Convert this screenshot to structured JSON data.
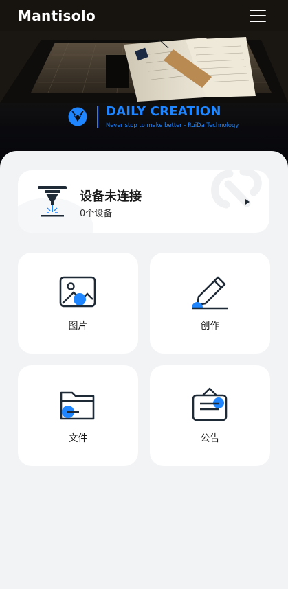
{
  "header": {
    "logo": "Mantisolo",
    "menu_icon": "hamburger-menu-icon"
  },
  "brand": {
    "title": "DAILY CREATION",
    "subtitle": "Never stop to make better - RuiDa Technology",
    "badge_icon": "mantis-badge-icon"
  },
  "device": {
    "title": "设备未连接",
    "count_text": "0个设备",
    "icon": "laser-engraver-icon",
    "arrow_icon": "chevron-right-icon"
  },
  "tiles": [
    {
      "label": "图片",
      "icon": "image-icon"
    },
    {
      "label": "创作",
      "icon": "pen-icon"
    },
    {
      "label": "文件",
      "icon": "folder-icon"
    },
    {
      "label": "公告",
      "icon": "notice-board-icon"
    }
  ],
  "colors": {
    "accent": "#1f86ff",
    "text": "#1b1b1b",
    "background": "#f2f3f5",
    "card": "#ffffff"
  }
}
